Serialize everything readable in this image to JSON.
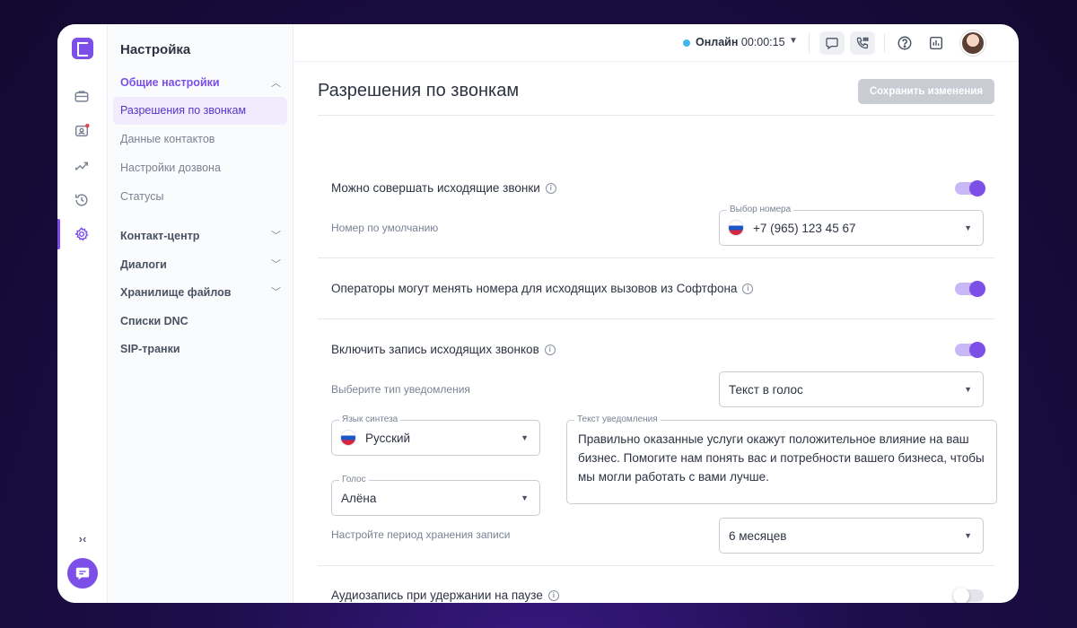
{
  "sidebar": {
    "title": "Настройка",
    "groups": [
      {
        "label": "Общие настройки",
        "open": true
      },
      {
        "label": "Контакт-центр"
      },
      {
        "label": "Диалоги"
      },
      {
        "label": "Хранилище файлов"
      },
      {
        "label": "Списки DNC"
      },
      {
        "label": "SIP-транки"
      }
    ],
    "items": [
      {
        "label": "Разрешения по звонкам",
        "active": true
      },
      {
        "label": "Данные контактов"
      },
      {
        "label": "Настройки дозвона"
      },
      {
        "label": "Статусы"
      }
    ]
  },
  "rail": {
    "icons": [
      "logo-icon",
      "briefcase-icon",
      "operator-icon",
      "trend-icon",
      "history-icon",
      "gear-icon",
      "collapse-icon",
      "chat-icon"
    ],
    "collapse_glyph": "›‹"
  },
  "topbar": {
    "status_label": "Онлайн",
    "status_timer": "00:00:15",
    "status_color": "#3fb6f0",
    "icons": [
      "chat-bubble-icon",
      "phone-dialpad-icon",
      "help-icon",
      "report-icon"
    ]
  },
  "main": {
    "title": "Разрешения по звонкам",
    "save_label": "Сохранить изменения",
    "outgoing": {
      "title": "Можно совершать исходящие звонки",
      "enabled": true,
      "default_number_label": "Номер по умолчанию",
      "number_field_label": "Выбор номера",
      "number_value": "+7 (965) 123 45 67"
    },
    "operators_change": {
      "title": "Операторы могут менять номера для исходящих вызовов из Софтфона",
      "enabled": true
    },
    "recording": {
      "title": "Включить запись исходящих звонков",
      "enabled": true,
      "notification_type_label": "Выберите тип уведомления",
      "notification_type_value": "Текст в голос",
      "language_label": "Язык синтеза",
      "language_value": "Русский",
      "voice_label": "Голос",
      "voice_value": "Алёна",
      "notification_text_label": "Текст уведомления",
      "notification_text": "Правильно оказанные услуги окажут положительное влияние на ваш бизнес. Помогите нам понять вас и потребности вашего бизнеса, чтобы мы могли работать с вами лучше.",
      "retention_label": "Настройте период хранения записи",
      "retention_value": "6 месяцев"
    },
    "hold_recording": {
      "title": "Аудиозапись при удержании на паузе",
      "enabled": false
    }
  },
  "colors": {
    "accent": "#7b4fe8",
    "background": "#1e0d4a",
    "save_disabled": "#c9ccd3"
  }
}
